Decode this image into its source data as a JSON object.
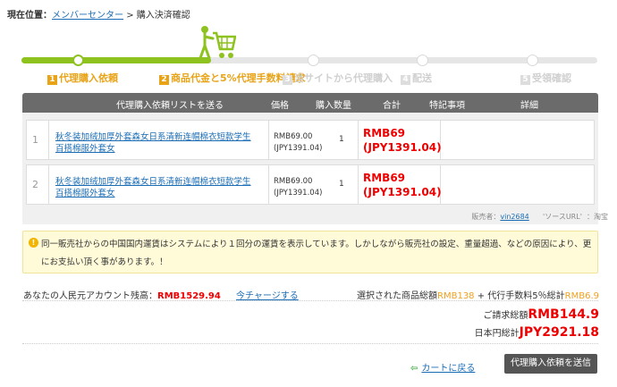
{
  "breadcrumb": {
    "label": "現在位置：",
    "link": "メンバーセンター",
    "sep": ">",
    "current": "購入決済確認"
  },
  "steps": [
    {
      "num": "1",
      "label": "代理購入依頼",
      "active": true
    },
    {
      "num": "2",
      "label": "商品代金と5%代理手数料請求",
      "active": true
    },
    {
      "num": "3",
      "label": "当サイトから代理購入",
      "active": false
    },
    {
      "num": "4",
      "label": "配送",
      "active": false
    },
    {
      "num": "5",
      "label": "受領確認",
      "active": false
    }
  ],
  "table": {
    "headers": [
      "代理購入依頼リストを送る",
      "価格",
      "購入数量",
      "合計",
      "特記事項",
      "詳細"
    ],
    "rows": [
      {
        "no": "1",
        "name": "秋冬装加绒加厚外套森女日系清新连帽棉衣短款学生百搭棉服外套女",
        "price_rmb": "RMB69.00",
        "price_jpy": "(JPY1391.04)",
        "qty": "1",
        "total_rmb": "RMB69",
        "total_jpy": "(JPY1391.04)"
      },
      {
        "no": "2",
        "name": "秋冬装加绒加厚外套森女日系清新连帽棉衣短款学生百搭棉服外套女",
        "price_rmb": "RMB69.00",
        "price_jpy": "(JPY1391.04)",
        "qty": "1",
        "total_rmb": "RMB69",
        "total_jpy": "(JPY1391.04)"
      }
    ],
    "seller_label": "販売者：",
    "seller": "vin2684",
    "source_label": "'ソースURL'",
    "source": "：淘宝"
  },
  "notice": "同一販売社からの中国国内運賃はシステムにより１回分の運賃を表示しています。しかしながら販売社の設定、重量超過、などの原因により、更にお支払い頂く事があります。！",
  "balance": {
    "label": "あなたの人民元アカウント残高：",
    "amount": "RMB1529.94",
    "charge_link": "今チャージする"
  },
  "summary": {
    "label1": "選択された商品総額",
    "amount1": "RMB138",
    "plus": " + 代行手数料5％総計",
    "amount2": "RMB6.9"
  },
  "bill": {
    "label": "ご請求総額",
    "amount": "RMB144.9"
  },
  "jpy_total": {
    "label": "日本円総計",
    "amount": "JPY2921.18"
  },
  "actions": {
    "back": "カートに戻る",
    "submit": "代理購入依頼を送信"
  },
  "colors": {
    "accent": "#8dc21f",
    "step_active": "#e8a317",
    "price_red": "#ee0000",
    "link": "#1a6cb5"
  }
}
